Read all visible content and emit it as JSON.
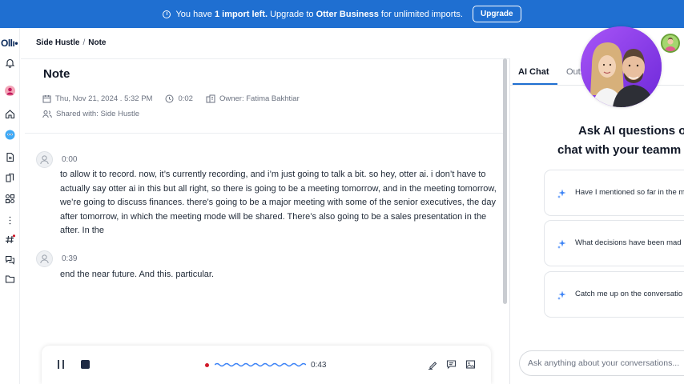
{
  "banner": {
    "text_prefix": "You have",
    "count_bold": "1 import left.",
    "text_middle": "Upgrade to",
    "plan_bold": "Otter Business",
    "text_suffix": "for unlimited imports.",
    "button": "Upgrade"
  },
  "rail": {
    "logo": "Ollı•"
  },
  "breadcrumb": {
    "parent": "Side Hustle",
    "separator": "/",
    "current": "Note"
  },
  "note": {
    "title": "Note",
    "date": "Thu, Nov 21, 2024 . 5:32 PM",
    "duration": "0:02",
    "owner": "Owner: Fatima Bakhtiar",
    "shared": "Shared with: Side Hustle"
  },
  "transcript": [
    {
      "time": "0:00",
      "text": "to allow it to record. now, it’s currently recording, and i’m just going to talk a bit. so hey, otter ai. i don’t have to actually say otter ai in this but all right, so there is going to be a meeting tomorrow, and in the meeting tomorrow, we’re going to discuss finances. there’s going to be a major meeting with some of the senior executives, the day after tomorrow, in which the meeting mode will be shared. There’s also going to be a sales presentation in the after. In the"
    },
    {
      "time": "0:39",
      "text": "end the near future. And this. particular."
    }
  ],
  "player": {
    "elapsed": "0:43"
  },
  "right": {
    "tabs": [
      "AI Chat",
      "Outl"
    ],
    "title_line1": "Ask AI questions o",
    "title_line2": "chat with your teamm",
    "suggestions": [
      "Have I mentioned so far in the m",
      "What decisions have been mad",
      "Catch me up on the conversatio"
    ],
    "input_placeholder": "Ask anything about your conversations..."
  },
  "colors": {
    "banner": "#1f6fd1",
    "accent": "#1f6fd1",
    "record": "#d11a2a",
    "stop": "#1e2a44"
  }
}
